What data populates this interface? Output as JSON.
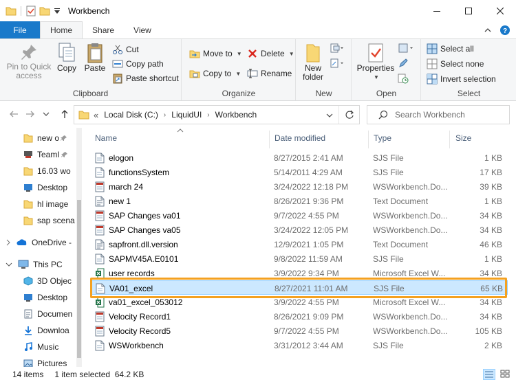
{
  "window": {
    "title": "Workbench"
  },
  "ribbon_tabs": [
    "File",
    "Home",
    "Share",
    "View"
  ],
  "clipboard": {
    "pin_label": "Pin to Quick access",
    "copy_label": "Copy",
    "paste_label": "Paste",
    "cut_label": "Cut",
    "copy_path_label": "Copy path",
    "paste_shortcut_label": "Paste shortcut",
    "group_label": "Clipboard"
  },
  "organize": {
    "move_to_label": "Move to",
    "copy_to_label": "Copy to",
    "delete_label": "Delete",
    "rename_label": "Rename",
    "group_label": "Organize"
  },
  "new_group": {
    "new_folder_label": "New folder",
    "group_label": "New"
  },
  "open_group": {
    "properties_label": "Properties",
    "group_label": "Open"
  },
  "select_group": {
    "select_all_label": "Select all",
    "select_none_label": "Select none",
    "invert_label": "Invert selection",
    "group_label": "Select"
  },
  "address": {
    "crumbs": [
      "Local Disk (C:)",
      "LiquidUI",
      "Workbench"
    ],
    "prefix": "«"
  },
  "search": {
    "placeholder": "Search Workbench"
  },
  "nav_pane": {
    "items": [
      {
        "label": "new o",
        "icon": "folder-icon"
      },
      {
        "label": "TeamI",
        "icon": "teamviewer-icon"
      },
      {
        "label": "16.03 wo",
        "icon": "folder-icon"
      },
      {
        "label": "Desktop",
        "icon": "desktop-icon"
      },
      {
        "label": "hl image",
        "icon": "folder-icon"
      },
      {
        "label": "sap scena",
        "icon": "folder-icon"
      },
      {
        "label": "OneDrive -",
        "icon": "onedrive-icon"
      },
      {
        "label": "This PC",
        "icon": "pc-icon"
      },
      {
        "label": "3D Objec",
        "icon": "3d-objects-icon"
      },
      {
        "label": "Desktop",
        "icon": "desktop-icon"
      },
      {
        "label": "Documen",
        "icon": "documents-icon"
      },
      {
        "label": "Downloa",
        "icon": "downloads-icon"
      },
      {
        "label": "Music",
        "icon": "music-icon"
      },
      {
        "label": "Pictures",
        "icon": "pictures-icon"
      }
    ]
  },
  "columns": {
    "name": "Name",
    "date": "Date modified",
    "type": "Type",
    "size": "Size"
  },
  "files": [
    {
      "name": "elogon",
      "date": "8/27/2015 2:41 AM",
      "type": "SJS File",
      "size": "1 KB",
      "icon": "sjs-file-icon"
    },
    {
      "name": "functionsSystem",
      "date": "5/14/2011 4:29 AM",
      "type": "SJS File",
      "size": "17 KB",
      "icon": "sjs-file-icon"
    },
    {
      "name": "march 24",
      "date": "3/24/2022 12:18 PM",
      "type": "WSWorkbench.Do...",
      "size": "39 KB",
      "icon": "workbench-doc-icon"
    },
    {
      "name": "new 1",
      "date": "8/26/2021 9:36 PM",
      "type": "Text Document",
      "size": "1 KB",
      "icon": "text-file-icon"
    },
    {
      "name": "SAP Changes va01",
      "date": "9/7/2022 4:55 PM",
      "type": "WSWorkbench.Do...",
      "size": "34 KB",
      "icon": "workbench-doc-icon"
    },
    {
      "name": "SAP Changes va05",
      "date": "3/24/2022 12:05 PM",
      "type": "WSWorkbench.Do...",
      "size": "34 KB",
      "icon": "workbench-doc-icon"
    },
    {
      "name": "sapfront.dll.version",
      "date": "12/9/2021 1:05 PM",
      "type": "Text Document",
      "size": "46 KB",
      "icon": "text-file-icon"
    },
    {
      "name": "SAPMV45A.E0101",
      "date": "9/8/2022 11:59 AM",
      "type": "SJS File",
      "size": "1 KB",
      "icon": "sjs-file-icon"
    },
    {
      "name": "user records",
      "date": "3/9/2022 9:34 PM",
      "type": "Microsoft Excel W...",
      "size": "34 KB",
      "icon": "excel-file-icon"
    },
    {
      "name": "VA01_excel",
      "date": "8/27/2021 11:01 AM",
      "type": "SJS File",
      "size": "65 KB",
      "icon": "sjs-file-icon",
      "selected": true
    },
    {
      "name": "va01_excel_053012",
      "date": "3/9/2022 4:55 PM",
      "type": "Microsoft Excel W...",
      "size": "34 KB",
      "icon": "excel-file-icon"
    },
    {
      "name": "Velocity Record1",
      "date": "8/26/2021 9:09 PM",
      "type": "WSWorkbench.Do...",
      "size": "34 KB",
      "icon": "workbench-doc-icon"
    },
    {
      "name": "Velocity Record5",
      "date": "9/7/2022 4:55 PM",
      "type": "WSWorkbench.Do...",
      "size": "105 KB",
      "icon": "workbench-doc-icon"
    },
    {
      "name": "WSWorkbench",
      "date": "3/31/2012 3:44 AM",
      "type": "SJS File",
      "size": "2 KB",
      "icon": "sjs-file-icon"
    }
  ],
  "status": {
    "items_count": "14 items",
    "selection": "1 item selected  64.2 KB"
  },
  "colors": {
    "file_tab": "#1979ca",
    "selection_bg": "#cce8ff",
    "selection_border": "#99d1ff",
    "highlight": "#f4a120"
  }
}
